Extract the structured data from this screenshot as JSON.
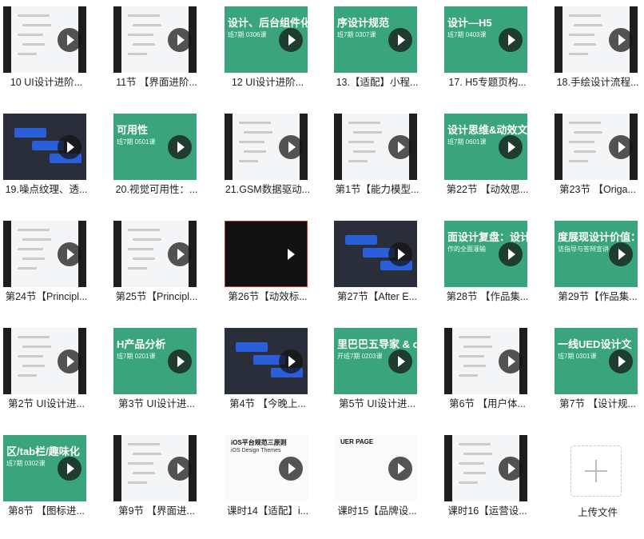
{
  "items": [
    {
      "title": "10  UI设计进阶..."
    },
    {
      "title": "11节 【界面进阶..."
    },
    {
      "title": "12  UI设计进阶..."
    },
    {
      "title": "13.【适配】小程..."
    },
    {
      "title": "17. H5专题页构..."
    },
    {
      "title": "18.手绘设计流程..."
    },
    {
      "title": "19.噪点纹理、透..."
    },
    {
      "title": "20.视觉可用性：..."
    },
    {
      "title": "21.GSM数据驱动..."
    },
    {
      "title": "第1节【能力模型..."
    },
    {
      "title": "第22节 【动效思..."
    },
    {
      "title": "第23节 【Origa..."
    },
    {
      "title": "第24节【Principl..."
    },
    {
      "title": "第25节【Principl..."
    },
    {
      "title": "第26节【动效标..."
    },
    {
      "title": "第27节【After E..."
    },
    {
      "title": "第28节 【作品集..."
    },
    {
      "title": "第29节【作品集..."
    },
    {
      "title": "第2节 UI设计进..."
    },
    {
      "title": "第3节 UI设计进..."
    },
    {
      "title": "第4节 【今晚上..."
    },
    {
      "title": "第5节 UI设计进..."
    },
    {
      "title": "第6节 【用户体..."
    },
    {
      "title": "第7节 【设计规..."
    },
    {
      "title": "第8节 【图标进..."
    },
    {
      "title": "第9节 【界面进..."
    },
    {
      "title": "课时14【适配】i..."
    },
    {
      "title": "课时15【品牌设..."
    },
    {
      "title": "课时16【运营设..."
    }
  ],
  "thumb_text": {
    "t2": "设计、后台组件化",
    "t2s": "班7期 0306课",
    "t3": "序设计规范",
    "t3s": "班7期 0307课",
    "t4": "设计—H5",
    "t4s": "班7期 0403课",
    "t7": "可用性",
    "t7s": "班7期 0501课",
    "t10": "设计思维&动效文档",
    "t10s": "班7期 0601课",
    "t16": "面设计复盘：设计前中",
    "t16s": "作的全面灌输",
    "t17": "度展现设计价值：",
    "t17s": "访指导与答辩宣讲",
    "t19": "H产品分析",
    "t19s": "班7期 0201课",
    "t21": "里巴巴五导家 & ok",
    "t21s": "开班7期 0203课",
    "t23": "一线UED设计文",
    "t23s": "班7期 0301课",
    "t24": "区/tab栏/趣味化",
    "t24s": "班7期 0302课",
    "t26": "iOS平台规范三原则",
    "t26s": "iOS Design Themes",
    "t27": "UER PAGE"
  },
  "upload": {
    "label": "上传文件"
  }
}
